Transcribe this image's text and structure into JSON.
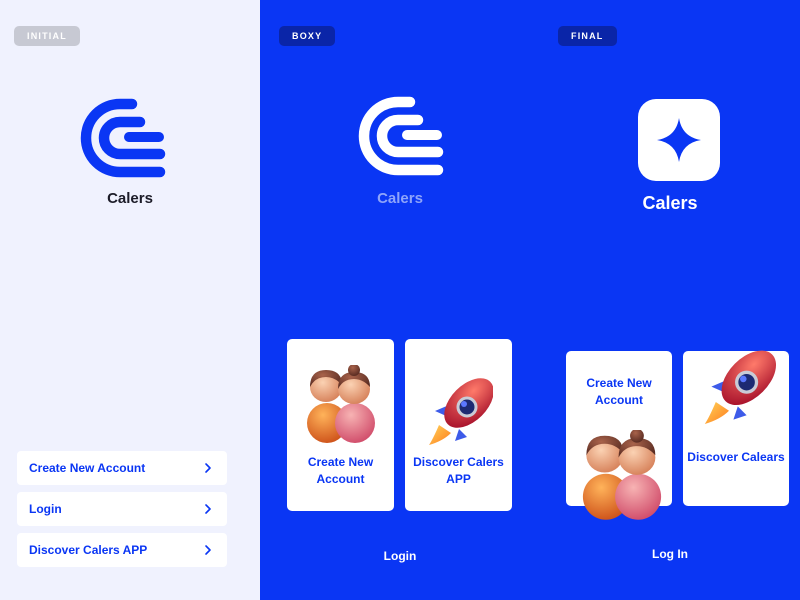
{
  "panels": {
    "initial": {
      "tag": "INITIAL",
      "brand": "Calers",
      "menu": [
        {
          "label": "Create New Account"
        },
        {
          "label": "Login"
        },
        {
          "label": "Discover Calers APP"
        }
      ]
    },
    "boxy": {
      "tag": "BOXY",
      "brand": "Calers",
      "cards": [
        {
          "label": "Create New Account"
        },
        {
          "label": "Discover Calers APP"
        }
      ],
      "footer": "Login"
    },
    "final": {
      "tag": "FINAL",
      "brand": "Calers",
      "cards": [
        {
          "label": "Create New Account"
        },
        {
          "label": "Discover Calears"
        }
      ],
      "footer": "Log In"
    }
  },
  "colors": {
    "brand_blue": "#0a36f4",
    "light_bg": "#f0f2fe",
    "tag_gray": "#c7c9d3",
    "tag_dark": "#0a25a8"
  },
  "icons": [
    "calers-logo-icon",
    "sparkle-star-icon",
    "chevron-right-icon",
    "people-illustration-icon",
    "rocket-illustration-icon"
  ]
}
